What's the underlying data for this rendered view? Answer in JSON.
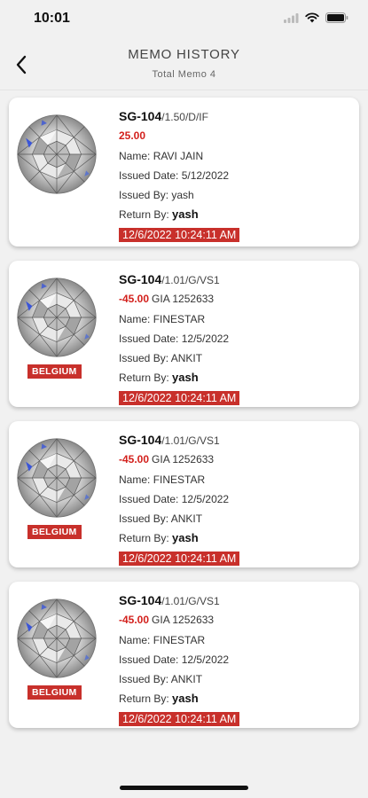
{
  "status_bar": {
    "time": "10:01"
  },
  "header": {
    "title": "MEMO HISTORY",
    "subtitle": "Total Memo 4"
  },
  "labels": {
    "name": "Name:",
    "issued_date": "Issued Date:",
    "issued_by": "Issued By:",
    "return_by": "Return By:"
  },
  "colors": {
    "accent_red": "#c8302b",
    "price_red": "#d3201c",
    "background": "#f1f1f1"
  },
  "icons": {
    "back": "chevron-left-icon",
    "signal": "signal-icon",
    "wifi": "wifi-icon",
    "battery": "battery-icon"
  },
  "memos": [
    {
      "sku": "SG-104",
      "spec": "/1.50/D/IF",
      "price": "25.00",
      "cert": "",
      "name": "RAVI JAIN",
      "issued_date": "5/12/2022",
      "issued_by": "yash",
      "return_by": "yash",
      "returned_at": "12/6/2022 10:24:11 AM",
      "origin": ""
    },
    {
      "sku": "SG-104",
      "spec": "/1.01/G/VS1",
      "price": "-45.00",
      "cert": "GIA 1252633",
      "name": "FINESTAR",
      "issued_date": "12/5/2022",
      "issued_by": "ANKIT",
      "return_by": "yash",
      "returned_at": "12/6/2022 10:24:11 AM",
      "origin": "BELGIUM"
    },
    {
      "sku": "SG-104",
      "spec": "/1.01/G/VS1",
      "price": "-45.00",
      "cert": "GIA 1252633",
      "name": "FINESTAR",
      "issued_date": "12/5/2022",
      "issued_by": "ANKIT",
      "return_by": "yash",
      "returned_at": "12/6/2022 10:24:11 AM",
      "origin": "BELGIUM"
    },
    {
      "sku": "SG-104",
      "spec": "/1.01/G/VS1",
      "price": "-45.00",
      "cert": "GIA 1252633",
      "name": "FINESTAR",
      "issued_date": "12/5/2022",
      "issued_by": "ANKIT",
      "return_by": "yash",
      "returned_at": "12/6/2022 10:24:11 AM",
      "origin": "BELGIUM"
    }
  ]
}
